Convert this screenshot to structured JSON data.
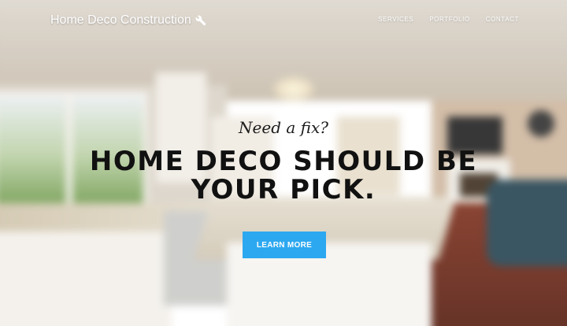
{
  "header": {
    "brand": "Home Deco Construction",
    "brand_icon": "wrench-icon",
    "nav": [
      {
        "label": "SERVICES"
      },
      {
        "label": "PORTFOLIO"
      },
      {
        "label": "CONTACT"
      }
    ]
  },
  "hero": {
    "subtitle": "Need a fix?",
    "title": "HOME DECO SHOULD BE YOUR PICK.",
    "cta_label": "LEARN MORE"
  },
  "colors": {
    "accent": "#2ca8f0",
    "heading": "#111111",
    "nav_text": "#ffffff"
  }
}
